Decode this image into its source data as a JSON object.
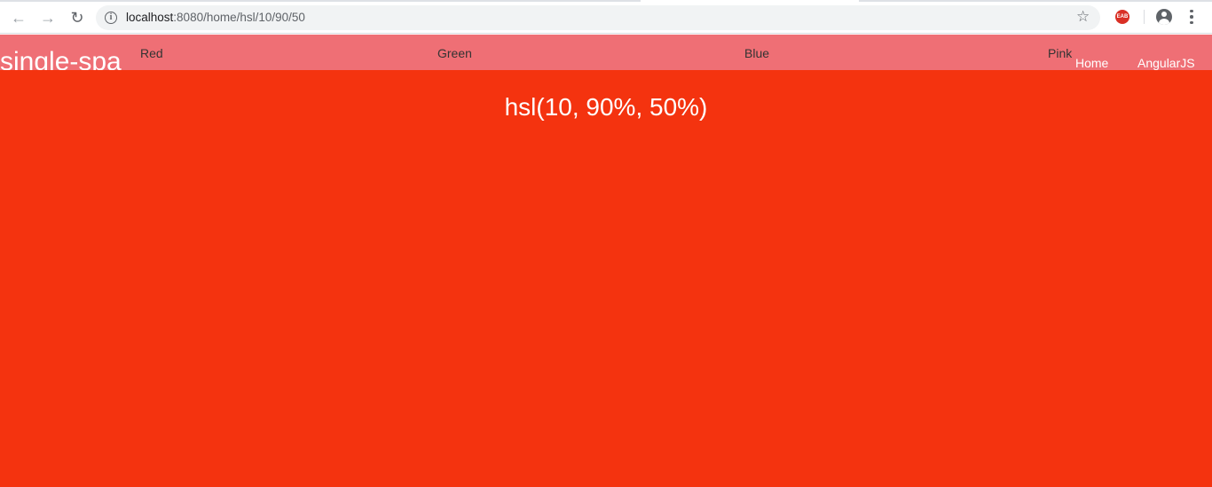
{
  "browser": {
    "url_host": "localhost",
    "url_rest": ":8080/home/hsl/10/90/50",
    "icons": {
      "back": "arrow-left-icon",
      "forward": "arrow-right-icon",
      "reload": "reload-icon",
      "info": "info-icon",
      "bookmark": "star-icon",
      "extension": "adblock-icon",
      "profile": "account-icon",
      "menu": "kebab-menu-icon"
    },
    "extension_label": "EAB"
  },
  "navbar": {
    "brand": "single-spa",
    "links": [
      "Red",
      "Green",
      "Blue",
      "Pink"
    ],
    "top_links": [
      "Home",
      "AngularJS"
    ],
    "background": "#ef6f75"
  },
  "content": {
    "heading": "hsl(10, 90%, 50%)",
    "background": "#f4330f"
  }
}
